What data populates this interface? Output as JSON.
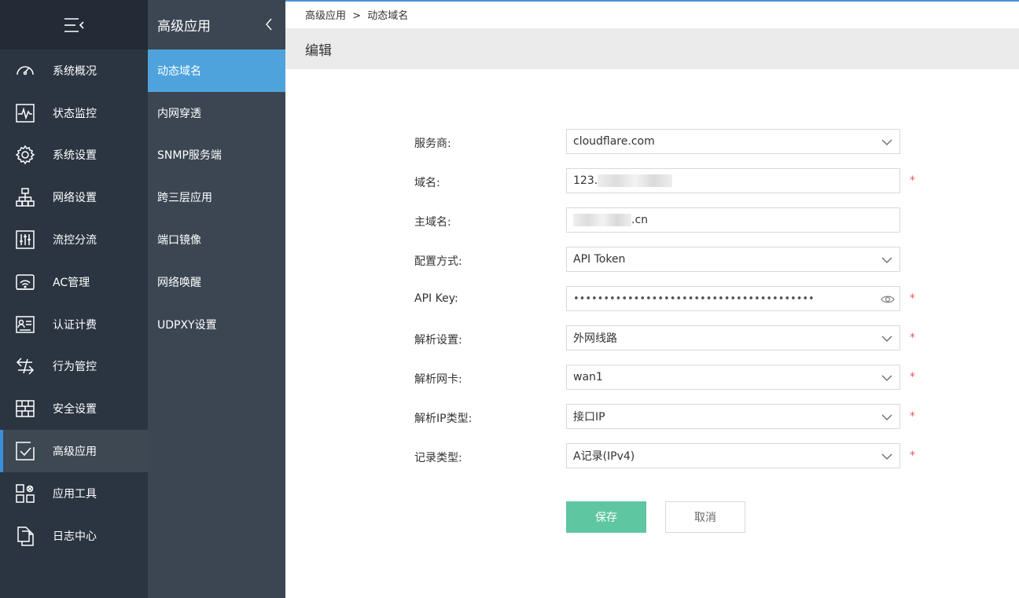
{
  "nav1": {
    "items": [
      {
        "label": "系统概况",
        "icon": "dashboard-icon"
      },
      {
        "label": "状态监控",
        "icon": "monitor-icon"
      },
      {
        "label": "系统设置",
        "icon": "gear-icon"
      },
      {
        "label": "网络设置",
        "icon": "network-icon"
      },
      {
        "label": "流控分流",
        "icon": "sliders-icon"
      },
      {
        "label": "AC管理",
        "icon": "wifi-icon"
      },
      {
        "label": "认证计费",
        "icon": "id-card-icon"
      },
      {
        "label": "行为管控",
        "icon": "exchange-icon"
      },
      {
        "label": "安全设置",
        "icon": "firewall-icon"
      },
      {
        "label": "高级应用",
        "icon": "checklist-icon"
      },
      {
        "label": "应用工具",
        "icon": "tools-icon"
      },
      {
        "label": "日志中心",
        "icon": "log-icon"
      }
    ],
    "active_index": 9
  },
  "nav2": {
    "title": "高级应用",
    "items": [
      {
        "label": "动态域名"
      },
      {
        "label": "内网穿透"
      },
      {
        "label": "SNMP服务端"
      },
      {
        "label": "跨三层应用"
      },
      {
        "label": "端口镜像"
      },
      {
        "label": "网络唤醒"
      },
      {
        "label": "UDPXY设置"
      }
    ],
    "active_index": 0
  },
  "breadcrumb": {
    "parent": "高级应用",
    "sep": ">",
    "current": "动态域名"
  },
  "page_title": "编辑",
  "form": {
    "provider": {
      "label": "服务商:",
      "value": "cloudflare.com"
    },
    "domain": {
      "label": "域名:",
      "value_prefix": "123.",
      "required": "*"
    },
    "main_domain": {
      "label": "主域名:",
      "value_suffix": ".cn"
    },
    "config_mode": {
      "label": "配置方式:",
      "value": "API Token"
    },
    "api_key": {
      "label": "API Key:",
      "value": "••••••••••••••••••••••••••••••••••••••••",
      "required": "*"
    },
    "resolve_setting": {
      "label": "解析设置:",
      "value": "外网线路",
      "required": "*"
    },
    "resolve_nic": {
      "label": "解析网卡:",
      "value": "wan1",
      "required": "*"
    },
    "resolve_ip_type": {
      "label": "解析IP类型:",
      "value": "接口IP",
      "required": "*"
    },
    "record_type": {
      "label": "记录类型:",
      "value": "A记录(IPv4)",
      "required": "*"
    }
  },
  "buttons": {
    "save": "保存",
    "cancel": "取消"
  },
  "colors": {
    "accent": "#4fa3dd",
    "save": "#5ec7a1",
    "required": "#e05a5a",
    "sidebar": "#2b3541"
  }
}
